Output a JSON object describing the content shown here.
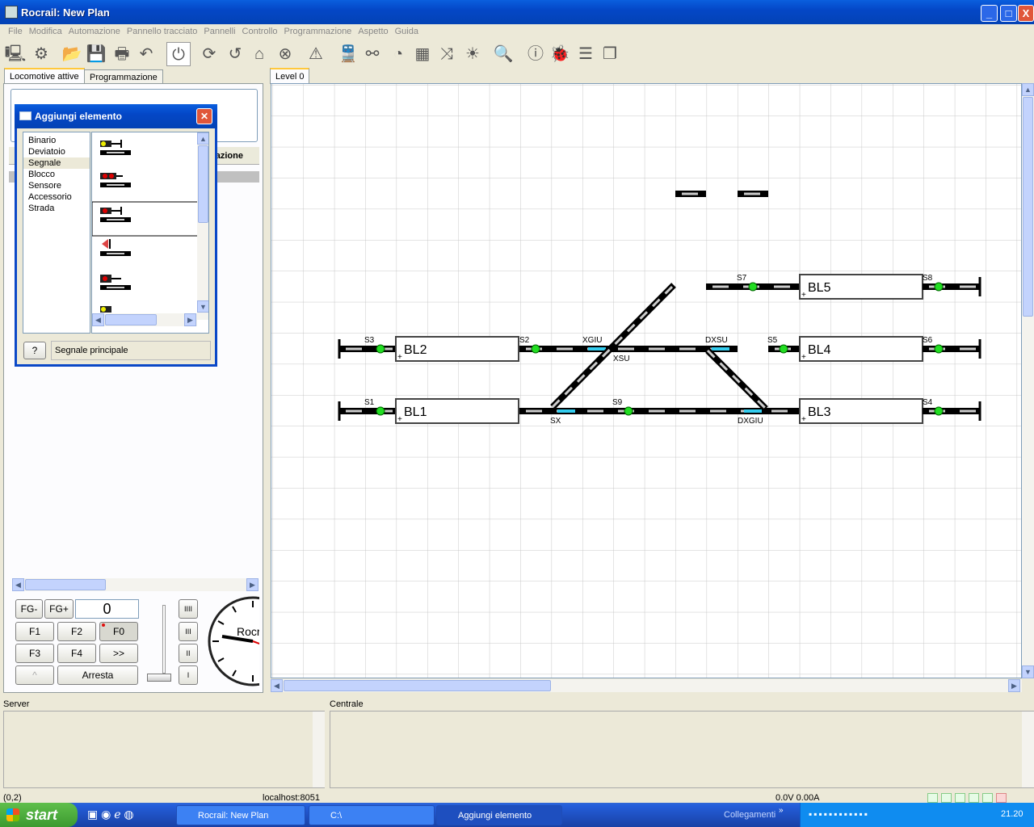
{
  "window": {
    "title": "Rocrail: New Plan",
    "minimize": "_",
    "maximize": "□",
    "close": "X"
  },
  "menu": [
    "File",
    "Modifica",
    "Automazione",
    "Pannello tracciato",
    "Pannelli",
    "Controllo",
    "Programmazione",
    "Aspetto",
    "Guida"
  ],
  "left_tabs": {
    "active": "Locomotive attive",
    "other": "Programmazione"
  },
  "plan_tab": "Level 0",
  "dialog": {
    "title": "Aggiungi elemento",
    "categories": [
      "Binario",
      "Deviatoio",
      "Segnale",
      "Blocco",
      "Sensore",
      "Accessorio",
      "Strada"
    ],
    "selected": "Segnale",
    "help_button": "?",
    "description": "Segnale principale"
  },
  "loco_table_header_fragment": "nazione",
  "controls": {
    "fg_minus": "FG-",
    "fg_plus": "FG+",
    "speed": "0",
    "f1": "F1",
    "f2": "F2",
    "f0": "F0",
    "f3": "F3",
    "f4": "F4",
    "more": ">>",
    "up": "^",
    "stop": "Arresta",
    "gears": [
      "IIII",
      "III",
      "II",
      "I"
    ],
    "clock_brand": "Rocr"
  },
  "plan": {
    "blocks": [
      "BL5",
      "BL2",
      "BL4",
      "BL1",
      "BL3"
    ],
    "signals": [
      "S7",
      "S8",
      "S3",
      "S2",
      "S5",
      "S6",
      "S1",
      "S9",
      "S4"
    ],
    "switches": [
      "XGIU",
      "XSU",
      "DXSU",
      "SX",
      "DXGIU"
    ]
  },
  "bottom": {
    "server_label": "Server",
    "central_label": "Centrale"
  },
  "status": {
    "coords": "(0,2)",
    "host": "localhost:8051",
    "power": "0.0V 0.00A"
  },
  "taskbar": {
    "start": "start",
    "tasks": [
      "Rocrail: New Plan",
      "C:\\",
      "Aggiungi elemento"
    ],
    "links": "Collegamenti",
    "time": "21.20"
  },
  "colors": {
    "signal_green": "#22dd22",
    "switch_cyan": "#33ccee",
    "track": "#000000",
    "xp_blue": "#0842c2"
  }
}
